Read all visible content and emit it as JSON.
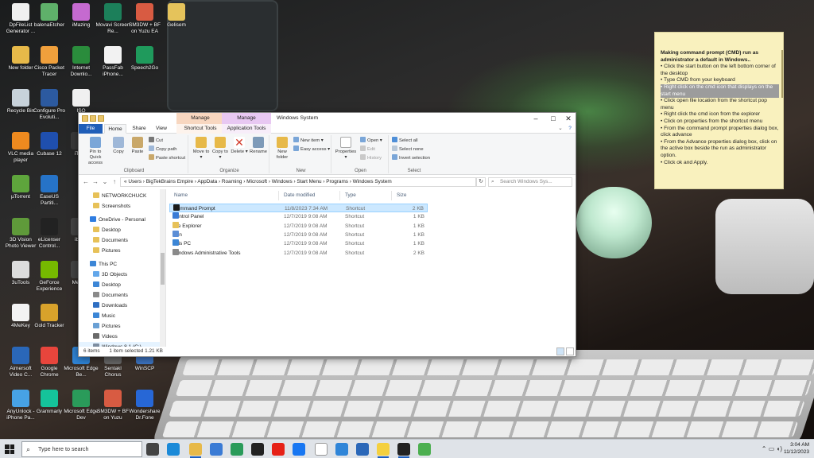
{
  "desktop": {
    "icons": [
      {
        "label": "DpFileList Generator ...",
        "color": "#f0f0f0"
      },
      {
        "label": "balenaEtcher",
        "color": "#5fb06a"
      },
      {
        "label": "iMazing",
        "color": "#c56ad0"
      },
      {
        "label": "Movavi Screen Re...",
        "color": "#1c7f5a"
      },
      {
        "label": "SM3DW + BF on Yuzu EA",
        "color": "#d85b42"
      },
      {
        "label": "Gelisem",
        "color": "#e5c35b"
      },
      {
        "label": "New folder",
        "color": "#e7b949"
      },
      {
        "label": "Cisco Packet Tracer",
        "color": "#f0a03c"
      },
      {
        "label": "Internet Downlo...",
        "color": "#2a8c3c"
      },
      {
        "label": "PassFab iPhone...",
        "color": "#f2f2f2"
      },
      {
        "label": "Speech2Go",
        "color": "#1f9a5c"
      },
      {
        "label": "Recycle Bin",
        "color": "#c7d2da"
      },
      {
        "label": "Configure Pro Evoluti...",
        "color": "#2c5aa0"
      },
      {
        "label": "ISO",
        "color": "#f0f0f0"
      },
      {
        "label": "VLC media player",
        "color": "#ee8a1f"
      },
      {
        "label": "Cubase 12",
        "color": "#1f4fae"
      },
      {
        "label": "iTub",
        "color": "#3a3a3a"
      },
      {
        "label": "µTorrent",
        "color": "#5ea53c"
      },
      {
        "label": "EaseUS Partiti...",
        "color": "#2673c7"
      },
      {
        "label": "3D Vision Photo Viewer",
        "color": "#5f9a3a"
      },
      {
        "label": "eLicenser Control...",
        "color": "#222"
      },
      {
        "label": "ibus",
        "color": "#444"
      },
      {
        "label": "3uTools",
        "color": "#dcdcdc"
      },
      {
        "label": "GeForce Experience",
        "color": "#76b900"
      },
      {
        "label": "Me Sh",
        "color": "#444"
      },
      {
        "label": "4MeKey",
        "color": "#f3f3f3"
      },
      {
        "label": "Gold Tracker",
        "color": "#d8a22b"
      },
      {
        "label": "Aimersoft Video C...",
        "color": "#2a67b8"
      },
      {
        "label": "Google Chrome",
        "color": "#e8453c"
      },
      {
        "label": "Microsoft Edge Be...",
        "color": "#2f85d8"
      },
      {
        "label": "Sentakl Chorus",
        "color": "#666"
      },
      {
        "label": "WinSCP",
        "color": "#3c74c2"
      },
      {
        "label": "AnyUnlock - iPhone Pa...",
        "color": "#47a2e5"
      },
      {
        "label": "Grammarly",
        "color": "#15c39a"
      },
      {
        "label": "Microsoft Edge Dev",
        "color": "#2a9b5a"
      },
      {
        "label": "SM3DW + BF on Yuzu",
        "color": "#d85b42"
      },
      {
        "label": "Wondershare Dr.Fone",
        "color": "#2767d6"
      }
    ],
    "sticky_note": {
      "title": "Making command prompt (CMD) run as administrator a default in Windows..",
      "lines": [
        "• Click the start button on the left bottom corner of the desktop",
        "• Type CMD from your keyboard",
        "• Right click on the cmd icon that displays on the start menu",
        "• Click open file location from the shortcut pop menu",
        "• Right click the cmd icon from the explorer",
        "• Click on properties from the shortcut menu",
        "• From the command prompt properties dialog box, click advance",
        "• From the Advance properties dialog box, click on the active box beside the run as administrator option.",
        "• Click ok and Apply."
      ]
    }
  },
  "explorer": {
    "window_title": "Windows System",
    "context_tabs": {
      "manage1": "Manage",
      "manage2": "Manage",
      "shortcut_tools": "Shortcut Tools",
      "application_tools": "Application Tools"
    },
    "tabs": {
      "file": "File",
      "home": "Home",
      "share": "Share",
      "view": "View"
    },
    "ribbon": {
      "clipboard": {
        "pin": "Pin to Quick access",
        "copy": "Copy",
        "paste": "Paste",
        "cut": "Cut",
        "copy_path": "Copy path",
        "paste_shortcut": "Paste shortcut",
        "group": "Clipboard"
      },
      "organize": {
        "move_to": "Move to ▾",
        "copy_to": "Copy to ▾",
        "delete": "Delete ▾",
        "rename": "Rename",
        "group": "Organize"
      },
      "new": {
        "new_folder": "New folder",
        "new_item": "New item ▾",
        "easy_access": "Easy access ▾",
        "group": "New"
      },
      "open": {
        "properties": "Properties ▾",
        "open": "Open ▾",
        "edit": "Edit",
        "history": "History",
        "group": "Open"
      },
      "select": {
        "select_all": "Select all",
        "select_none": "Select none",
        "invert": "Invert selection",
        "group": "Select"
      }
    },
    "address": {
      "path": "«  Users  ›  BigTekBrains Empire  ›  AppData  ›  Roaming  ›  Microsoft  ›  Windows  ›  Start Menu  ›  Programs  ›  Windows System",
      "search_placeholder": "Search Windows Sys..."
    },
    "nav_pane": [
      {
        "label": "NETWORKCHUCK",
        "color": "#e7c158"
      },
      {
        "label": "Screenshots",
        "color": "#e7c158"
      },
      {
        "label": "OneDrive - Personal",
        "color": "#2f7de1"
      },
      {
        "label": "Desktop",
        "color": "#e7c158"
      },
      {
        "label": "Documents",
        "color": "#e7c158"
      },
      {
        "label": "Pictures",
        "color": "#e7c158"
      },
      {
        "label": "This PC",
        "color": "#3c86d6"
      },
      {
        "label": "3D Objects",
        "color": "#63a7ea"
      },
      {
        "label": "Desktop",
        "color": "#3c86d6"
      },
      {
        "label": "Documents",
        "color": "#8a8a8a"
      },
      {
        "label": "Downloads",
        "color": "#2f6fc2"
      },
      {
        "label": "Music",
        "color": "#3c86d6"
      },
      {
        "label": "Pictures",
        "color": "#6aa0d4"
      },
      {
        "label": "Videos",
        "color": "#6a6a6a"
      },
      {
        "label": "Windows 8.1 (C:)",
        "color": "#7d8da0"
      }
    ],
    "columns": {
      "name": "Name",
      "date": "Date modified",
      "type": "Type",
      "size": "Size"
    },
    "files": [
      {
        "name": "Command Prompt",
        "date": "11/8/2023 7:34 AM",
        "type": "Shortcut",
        "size": "2 KB",
        "icon_color": "#1b1b1b"
      },
      {
        "name": "Control Panel",
        "date": "12/7/2019 9:08 AM",
        "type": "Shortcut",
        "size": "1 KB",
        "icon_color": "#3a7bd5"
      },
      {
        "name": "File Explorer",
        "date": "12/7/2019 9:08 AM",
        "type": "Shortcut",
        "size": "1 KB",
        "icon_color": "#e7c158"
      },
      {
        "name": "Run",
        "date": "12/7/2019 9:08 AM",
        "type": "Shortcut",
        "size": "1 KB",
        "icon_color": "#5c8ed6"
      },
      {
        "name": "This PC",
        "date": "12/7/2019 9:08 AM",
        "type": "Shortcut",
        "size": "1 KB",
        "icon_color": "#3c86d6"
      },
      {
        "name": "Windows Administrative Tools",
        "date": "12/7/2019 9:08 AM",
        "type": "Shortcut",
        "size": "2 KB",
        "icon_color": "#8a8a8a"
      }
    ],
    "status": {
      "items": "6 items",
      "selected": "1 item selected  1.21 KB"
    }
  },
  "taskbar": {
    "search_placeholder": "Type here to search",
    "time": "3:04 AM",
    "date": "11/12/2023",
    "apps": [
      {
        "name": "task-view-icon",
        "color": "#444"
      },
      {
        "name": "edge-icon",
        "color": "#1b8ad8"
      },
      {
        "name": "file-explorer-icon",
        "color": "#e7b949"
      },
      {
        "name": "store-icon",
        "color": "#3a7bd5"
      },
      {
        "name": "edge-dev-icon",
        "color": "#2a9b5a"
      },
      {
        "name": "amazon-icon",
        "color": "#222"
      },
      {
        "name": "youtube-icon",
        "color": "#e62117"
      },
      {
        "name": "facebook-icon",
        "color": "#1877f2"
      },
      {
        "name": "wikipedia-icon",
        "color": "#ffffff"
      },
      {
        "name": "edge-beta-icon",
        "color": "#2f85d8"
      },
      {
        "name": "mail-icon",
        "color": "#2a67b8"
      },
      {
        "name": "sticky-notes-icon",
        "color": "#f4d03f"
      },
      {
        "name": "terminal-icon",
        "color": "#222"
      },
      {
        "name": "app-icon",
        "color": "#4caf50"
      }
    ]
  }
}
